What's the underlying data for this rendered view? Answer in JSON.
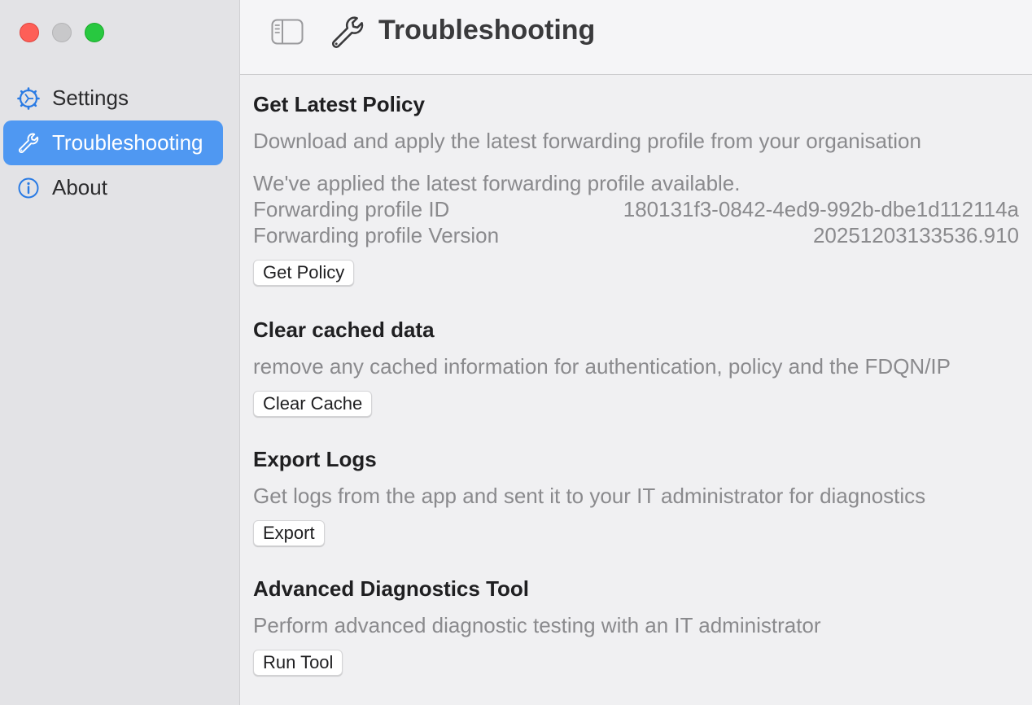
{
  "window": {
    "controls": [
      "close",
      "minimize",
      "maximize"
    ]
  },
  "sidebar": {
    "items": [
      {
        "label": "Settings",
        "icon": "gear-icon",
        "active": false
      },
      {
        "label": "Troubleshooting",
        "icon": "wrench-icon",
        "active": true
      },
      {
        "label": "About",
        "icon": "info-icon",
        "active": false
      }
    ]
  },
  "header": {
    "title": "Troubleshooting",
    "icon": "wrench-icon"
  },
  "sections": {
    "policy": {
      "title": "Get Latest Policy",
      "description": "Download and apply the latest forwarding profile from your organisation",
      "status": "We've applied the latest forwarding profile available.",
      "profile_id_label": "Forwarding profile ID",
      "profile_id_value": "180131f3-0842-4ed9-992b-dbe1d112114a",
      "profile_version_label": "Forwarding profile Version",
      "profile_version_value": "20251203133536.910",
      "button": "Get Policy"
    },
    "cache": {
      "title": "Clear cached data",
      "description": "remove any cached information for authentication, policy and the FDQN/IP",
      "button": "Clear Cache"
    },
    "logs": {
      "title": "Export Logs",
      "description": "Get logs from the app and sent it to your IT administrator for diagnostics",
      "button": "Export"
    },
    "diagnostics": {
      "title": "Advanced Diagnostics Tool",
      "description": "Perform advanced diagnostic testing with an IT administrator",
      "button": "Run Tool"
    }
  },
  "colors": {
    "accent": "#4f98f2",
    "sidebar_bg": "#e3e3e6",
    "content_bg": "#f0f0f2"
  }
}
